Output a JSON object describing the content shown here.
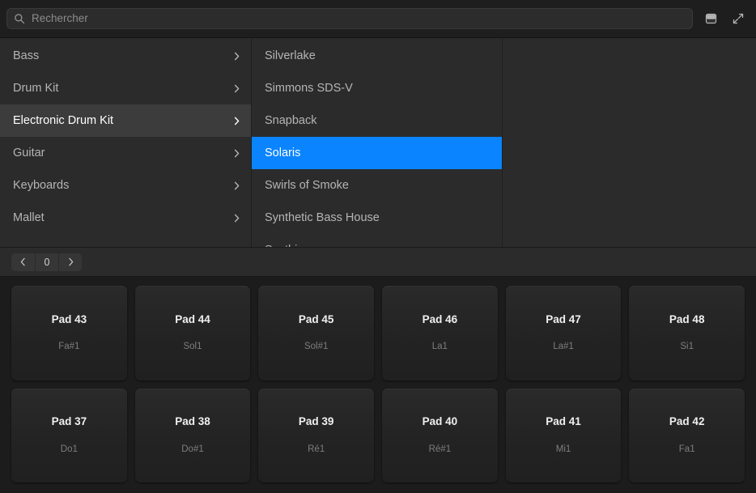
{
  "search": {
    "placeholder": "Rechercher",
    "value": "",
    "icon": "search-icon"
  },
  "topbar": {
    "view_toggle_icon": "panel-view-icon",
    "collapse_icon": "collapse-arrows-icon"
  },
  "browser": {
    "categories": [
      {
        "label": "Bass",
        "state": "normal",
        "chevron": "chevron-right-icon"
      },
      {
        "label": "Drum Kit",
        "state": "normal",
        "chevron": "chevron-right-icon"
      },
      {
        "label": "Electronic Drum Kit",
        "state": "active",
        "chevron": "chevron-right-icon"
      },
      {
        "label": "Guitar",
        "state": "normal",
        "chevron": "chevron-right-icon"
      },
      {
        "label": "Keyboards",
        "state": "normal",
        "chevron": "chevron-right-icon"
      },
      {
        "label": "Mallet",
        "state": "normal",
        "chevron": "chevron-right-icon"
      }
    ],
    "presets": [
      {
        "label": "Silverlake",
        "state": "normal"
      },
      {
        "label": "Simmons SDS-V",
        "state": "normal"
      },
      {
        "label": "Snapback",
        "state": "normal"
      },
      {
        "label": "Solaris",
        "state": "selected"
      },
      {
        "label": "Swirls of Smoke",
        "state": "normal"
      },
      {
        "label": "Synthetic Bass House",
        "state": "normal"
      },
      {
        "label": "Synthia",
        "state": "normal"
      }
    ],
    "selection_color": "#0a84ff",
    "detail_panel": {
      "content": ""
    }
  },
  "pager": {
    "prev_icon": "chevron-left-icon",
    "next_icon": "chevron-right-icon",
    "value": "0"
  },
  "pads": {
    "rows": [
      [
        {
          "name": "Pad 43",
          "note": "Fa#1"
        },
        {
          "name": "Pad 44",
          "note": "Sol1"
        },
        {
          "name": "Pad 45",
          "note": "Sol#1"
        },
        {
          "name": "Pad 46",
          "note": "La1"
        },
        {
          "name": "Pad 47",
          "note": "La#1"
        },
        {
          "name": "Pad 48",
          "note": "Si1"
        }
      ],
      [
        {
          "name": "Pad 37",
          "note": "Do1"
        },
        {
          "name": "Pad 38",
          "note": "Do#1"
        },
        {
          "name": "Pad 39",
          "note": "Ré1"
        },
        {
          "name": "Pad 40",
          "note": "Ré#1"
        },
        {
          "name": "Pad 41",
          "note": "Mi1"
        },
        {
          "name": "Pad 42",
          "note": "Fa1"
        }
      ]
    ]
  }
}
